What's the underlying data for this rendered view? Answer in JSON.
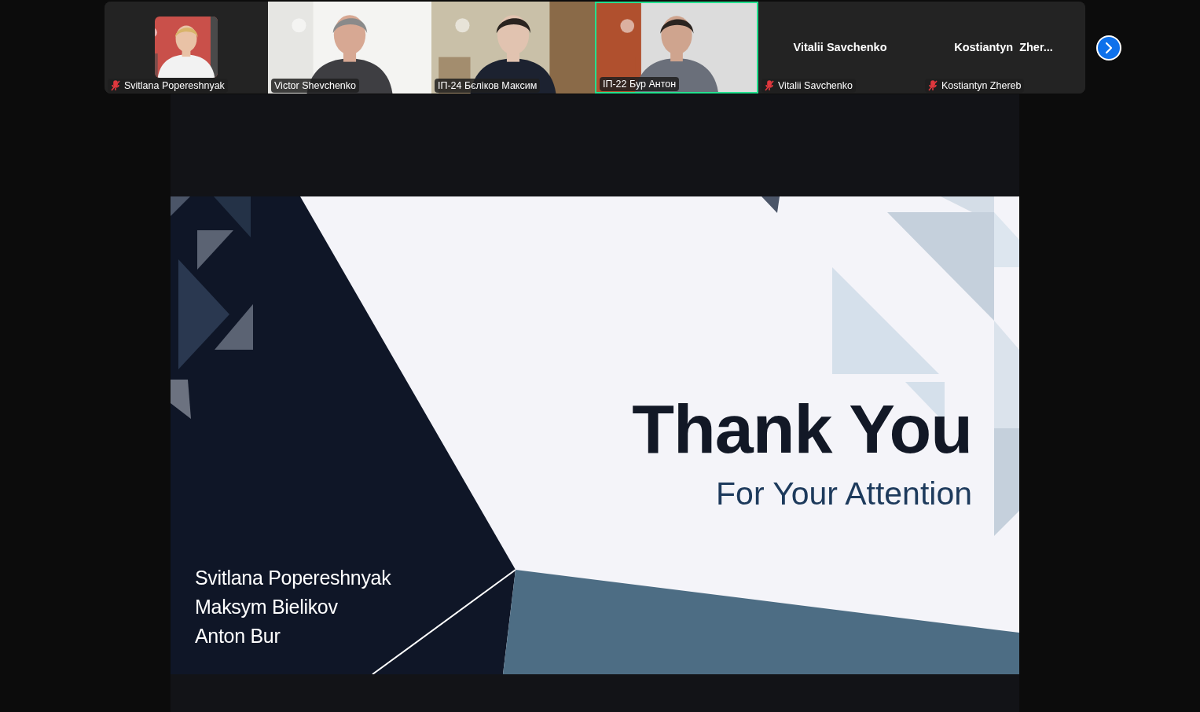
{
  "participants": [
    {
      "name": "Svitlana Popereshnyak",
      "kind": "avatar",
      "muted": true,
      "active_speaker": false
    },
    {
      "name": "Victor Shevchenko",
      "kind": "video",
      "muted": false,
      "active_speaker": false
    },
    {
      "name": "ІП-24 Бєліков Максим",
      "kind": "video",
      "muted": false,
      "active_speaker": false
    },
    {
      "name": "ІП-22 Бур Антон",
      "kind": "video",
      "muted": false,
      "active_speaker": true
    },
    {
      "name": "Vitalii Savchenko",
      "kind": "name",
      "display_name": "Vitalii Savchenko",
      "muted": true,
      "active_speaker": false
    },
    {
      "name": "Kostiantyn Zhereb",
      "kind": "name",
      "display_name": "Kostiantyn  Zher...",
      "muted": true,
      "active_speaker": false
    }
  ],
  "slide": {
    "title": "Thank You",
    "subtitle": "For Your Attention",
    "authors": [
      "Svitlana Popereshnyak",
      "Maksym Bielikov",
      "Anton Bur"
    ]
  }
}
